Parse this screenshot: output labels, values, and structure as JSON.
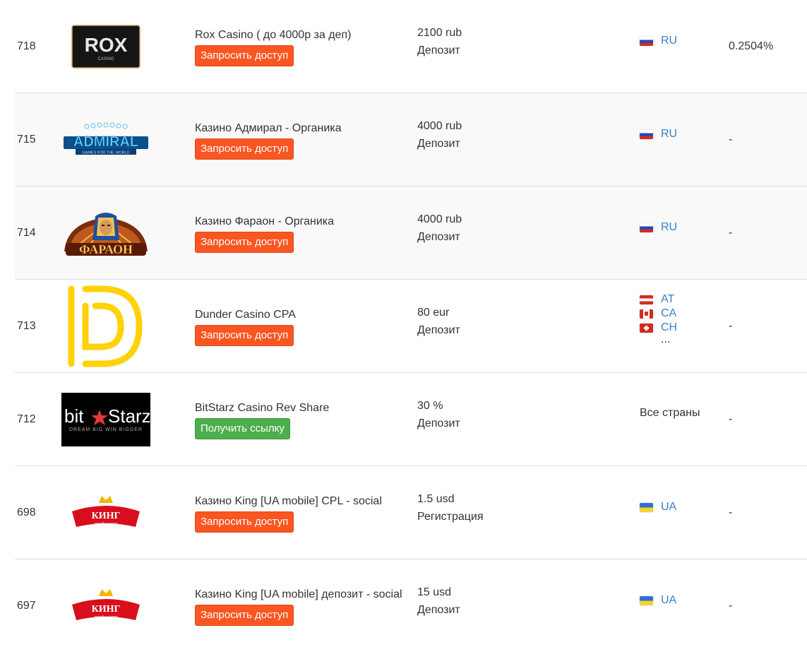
{
  "rows": [
    {
      "id": "718",
      "logo": "rox-casino-logo",
      "logo_text": "ROX",
      "logo_sub": "CASINO",
      "title": "Rox Casino ( до 4000р за деп)",
      "button": "Запросить доступ",
      "button_type": "request",
      "amount": "2100 rub",
      "pay_type": "Депозит",
      "geo": [
        {
          "flag": "ru",
          "code": "RU"
        }
      ],
      "cr": "0.2504%"
    },
    {
      "id": "715",
      "logo": "admiral-casino-logo",
      "logo_text": "ADMIRAL",
      "logo_sub": "GAMES FOR THE WORLD",
      "title": "Казино Адмирал - Органика",
      "button": "Запросить доступ",
      "button_type": "request",
      "amount": "4000 rub",
      "pay_type": "Депозит",
      "geo": [
        {
          "flag": "ru",
          "code": "RU"
        }
      ],
      "cr": "-"
    },
    {
      "id": "714",
      "logo": "pharaoh-casino-logo",
      "logo_text": "ФАРАОН",
      "title": "Казино Фараон - Органика",
      "button": "Запросить доступ",
      "button_type": "request",
      "amount": "4000 rub",
      "pay_type": "Депозит",
      "geo": [
        {
          "flag": "ru",
          "code": "RU"
        }
      ],
      "cr": "-"
    },
    {
      "id": "713",
      "logo": "dunder-casino-logo",
      "title": "Dunder Casino CPA",
      "button": "Запросить доступ",
      "button_type": "request",
      "amount": "80 eur",
      "pay_type": "Депозит",
      "geo": [
        {
          "flag": "at",
          "code": "AT"
        },
        {
          "flag": "ca",
          "code": "CA"
        },
        {
          "flag": "ch",
          "code": "CH"
        }
      ],
      "geo_more": "...",
      "cr": "-"
    },
    {
      "id": "712",
      "logo": "bitstarz-casino-logo",
      "logo_text_a": "bit",
      "logo_text_b": "Starz",
      "logo_sub": "DREAM BIG WIN BIGGER",
      "title": "BitStarz Casino Rev Share",
      "button": "Получить ссылку",
      "button_type": "get",
      "amount": "30 %",
      "pay_type": "Депозит",
      "geo_all": "Все страны",
      "cr": "-"
    },
    {
      "id": "698",
      "logo": "king-casino-logo",
      "logo_text": "КИНГ",
      "logo_sub": "онлайн казино",
      "title": "Казино King [UA mobile] CPL - social",
      "button": "Запросить доступ",
      "button_type": "request",
      "amount": "1.5 usd",
      "pay_type": "Регистрация",
      "geo": [
        {
          "flag": "ua",
          "code": "UA"
        }
      ],
      "cr": "-"
    },
    {
      "id": "697",
      "logo": "king-casino-logo",
      "logo_text": "КИНГ",
      "logo_sub": "онлайн казино",
      "title": "Казино King [UA mobile] депозит - social",
      "button": "Запросить доступ",
      "button_type": "request",
      "amount": "15 usd",
      "pay_type": "Депозит",
      "geo": [
        {
          "flag": "ua",
          "code": "UA"
        }
      ],
      "cr": "-"
    }
  ]
}
